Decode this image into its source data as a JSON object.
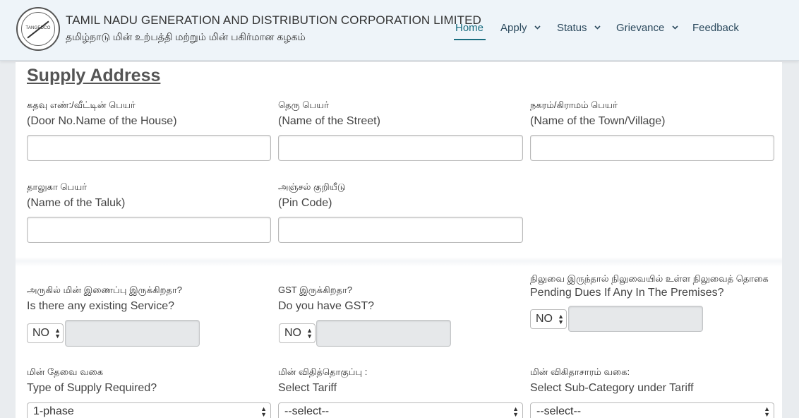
{
  "header": {
    "logo_text": "TANGEDCO",
    "org_name_en": "TAMIL NADU GENERATION AND DISTRIBUTION CORPORATION LIMITED",
    "org_name_ta": "தமிழ்நாடு மின் உற்பத்தி மற்றும் மின் பகிர்மான கழகம்"
  },
  "nav": {
    "home": "Home",
    "apply": "Apply",
    "status": "Status",
    "grievance": "Grievance",
    "feedback": "Feedback"
  },
  "section": {
    "title": "Supply Address"
  },
  "address": {
    "door": {
      "ta": "கதவு எண்:/வீட்டின் பெயர்",
      "en": "(Door No.Name of the House)",
      "value": ""
    },
    "street": {
      "ta": "தெரு பெயர்",
      "en": "(Name of the Street)",
      "value": ""
    },
    "town": {
      "ta": "நகரம்/கிராமம் பெயர்",
      "en": "(Name of the Town/Village)",
      "value": ""
    },
    "taluk": {
      "ta": "தாலுகா பெயர்",
      "en": "(Name of the Taluk)",
      "value": ""
    },
    "pincode": {
      "ta": "அஞ்சல் குறியீடு",
      "en": "(Pin Code)",
      "value": ""
    }
  },
  "service": {
    "existing": {
      "ta": "அருகில் மின் இணைப்பு இருக்கிறதா?",
      "en": "Is there any existing Service?",
      "selected": "NO",
      "value": ""
    },
    "gst": {
      "ta": "GST இருக்கிறதா?",
      "en": "Do you have GST?",
      "selected": "NO",
      "value": ""
    },
    "dues": {
      "ta": "நிலுவை இருந்தால் நிலுவையில் உள்ள நிலுவைத் தொகை",
      "en": "Pending Dues If Any In The Premises?",
      "selected": "NO",
      "value": ""
    }
  },
  "supply": {
    "type": {
      "ta": "மின் தேவை வகை",
      "en": "Type of Supply Required?",
      "selected": "1-phase"
    },
    "tariff": {
      "ta": "மின் விதித்தொகுப்பு :",
      "en": "Select Tariff",
      "selected": "--select--"
    },
    "subcat": {
      "ta": "மின் விகிதாசாரம் வகை:",
      "en": "Select Sub-Category under Tariff",
      "selected": "--select--"
    }
  },
  "icons": {
    "select_arrows": "updown-arrows-icon",
    "dropdown": "chevron-down-icon",
    "logo": "tangedco-logo-icon"
  },
  "colors": {
    "header_bg": "#eef4f9",
    "nav_active": "#1a6d80",
    "nav_text": "#2c4a5e",
    "panel_bg": "#ffffff",
    "page_bg": "#e9ecef"
  }
}
